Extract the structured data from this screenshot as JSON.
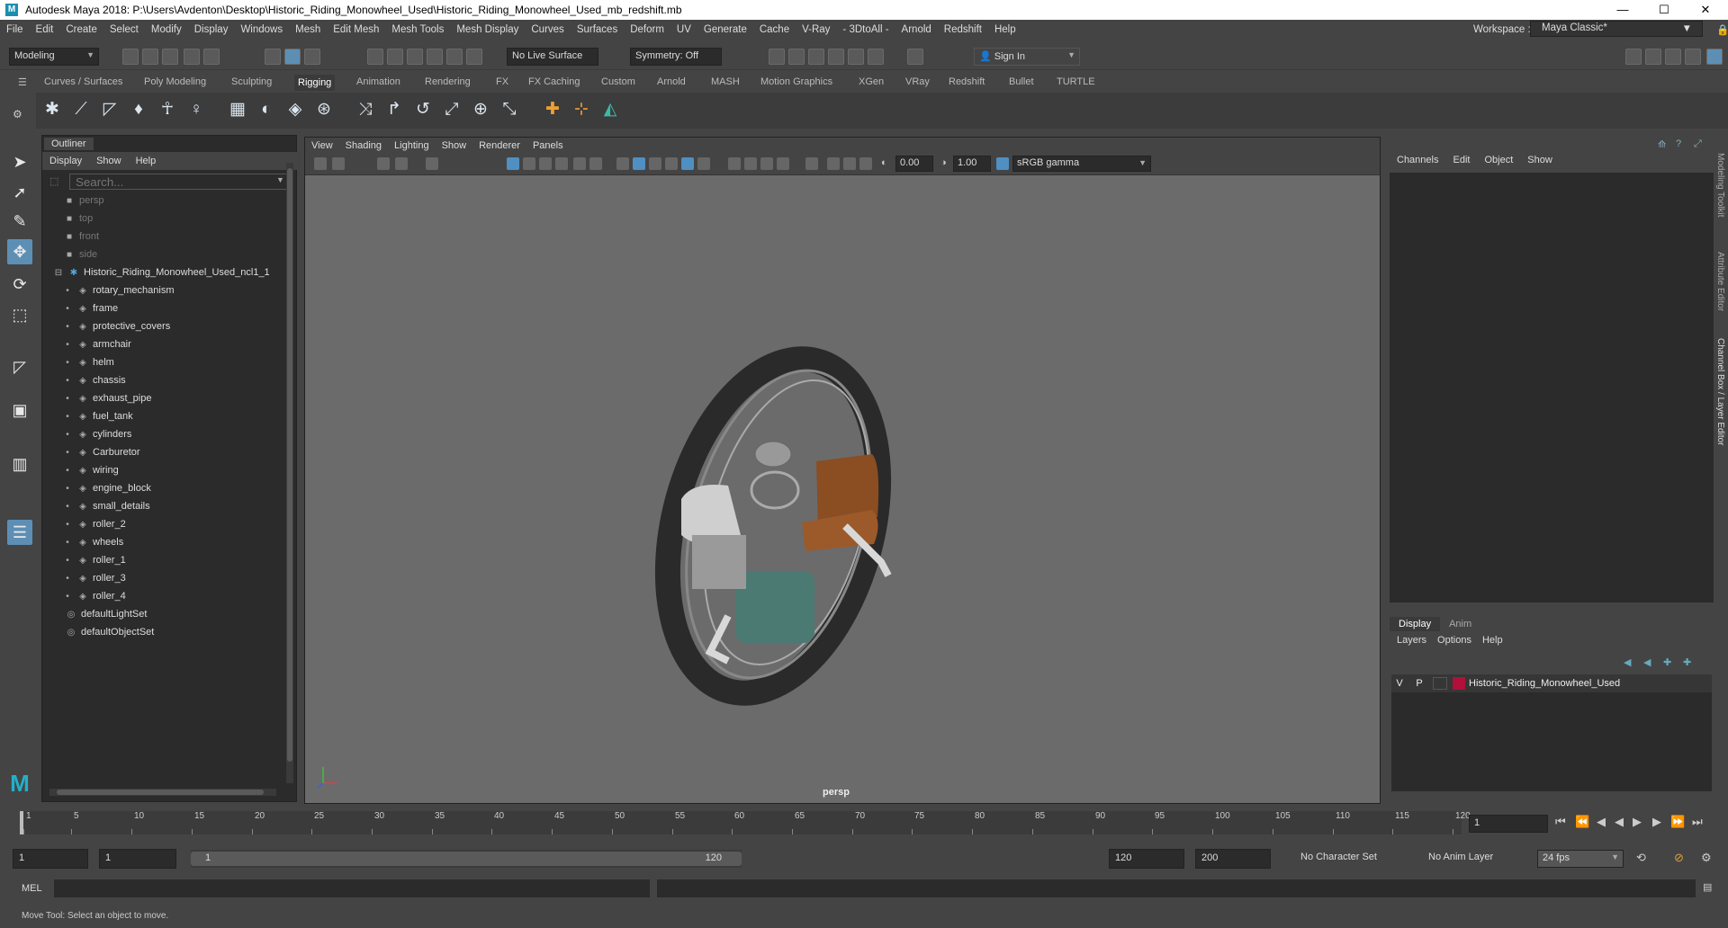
{
  "title": "Autodesk Maya 2018: P:\\Users\\Avdenton\\Desktop\\Historic_Riding_Monowheel_Used\\Historic_Riding_Monowheel_Used_mb_redshift.mb",
  "window_controls": {
    "minimize": "—",
    "maximize": "☐",
    "close": "✕"
  },
  "menubar": [
    "File",
    "Edit",
    "Create",
    "Select",
    "Modify",
    "Display",
    "Windows",
    "Mesh",
    "Edit Mesh",
    "Mesh Tools",
    "Mesh Display",
    "Curves",
    "Surfaces",
    "Deform",
    "UV",
    "Generate",
    "Cache",
    "V-Ray",
    "- 3DtoAll -",
    "Arnold",
    "Redshift",
    "Help"
  ],
  "workspace": {
    "label": "Workspace :",
    "value": "Maya Classic*"
  },
  "statusline": {
    "mode": "Modeling",
    "live_surface": "No Live Surface",
    "symmetry": "Symmetry: Off",
    "sign_in": "Sign In"
  },
  "shelf_tabs": [
    "Curves / Surfaces",
    "Poly Modeling",
    "Sculpting",
    "Rigging",
    "Animation",
    "Rendering",
    "FX",
    "FX Caching",
    "Custom",
    "Arnold",
    "MASH",
    "Motion Graphics",
    "XGen",
    "VRay",
    "Redshift",
    "Bullet",
    "TURTLE"
  ],
  "shelf_active": "Rigging",
  "outliner": {
    "tab": "Outliner",
    "menu": [
      "Display",
      "Show",
      "Help"
    ],
    "search_placeholder": "Search...",
    "cameras": [
      "persp",
      "top",
      "front",
      "side"
    ],
    "group": "Historic_Riding_Monowheel_Used_ncl1_1",
    "children": [
      "rotary_mechanism",
      "frame",
      "protective_covers",
      "armchair",
      "helm",
      "chassis",
      "exhaust_pipe",
      "fuel_tank",
      "cylinders",
      "Carburetor",
      "wiring",
      "engine_block",
      "small_details",
      "roller_2",
      "wheels",
      "roller_1",
      "roller_3",
      "roller_4"
    ],
    "sets": [
      "defaultLightSet",
      "defaultObjectSet"
    ]
  },
  "viewport": {
    "menu": [
      "View",
      "Shading",
      "Lighting",
      "Show",
      "Renderer",
      "Panels"
    ],
    "exposure": "0.00",
    "gamma": "1.00",
    "color_space": "sRGB gamma",
    "camera": "persp"
  },
  "channel_box": {
    "menu": [
      "Channels",
      "Edit",
      "Object",
      "Show"
    ],
    "side_tabs": [
      "Modeling Toolkit",
      "Attribute Editor",
      "Channel Box / Layer Editor"
    ]
  },
  "layer_editor": {
    "tabs": [
      "Display",
      "Anim"
    ],
    "menu": [
      "Layers",
      "Options",
      "Help"
    ],
    "layer": {
      "v": "V",
      "p": "P",
      "name": "Historic_Riding_Monowheel_Used",
      "color": "#b0103a"
    }
  },
  "timeline": {
    "ticks": [
      "1",
      "5",
      "10",
      "15",
      "20",
      "25",
      "30",
      "35",
      "40",
      "45",
      "50",
      "55",
      "60",
      "65",
      "70",
      "75",
      "80",
      "85",
      "90",
      "95",
      "100",
      "105",
      "110",
      "115",
      "120"
    ],
    "current_frame": "1"
  },
  "range": {
    "start": "1",
    "anim_start": "1",
    "slider_start": "1",
    "slider_end": "120",
    "end": "120",
    "anim_end": "200",
    "character_set": "No Character Set",
    "anim_layer": "No Anim Layer",
    "fps": "24 fps"
  },
  "cmdline": {
    "label": "MEL"
  },
  "helpline": "Move Tool: Select an object to move."
}
